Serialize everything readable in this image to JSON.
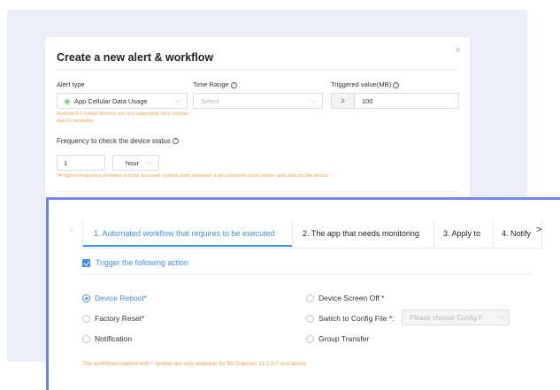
{
  "dialog": {
    "title": "Create a new alert & workflow",
    "close_icon": "×",
    "alert_type_label": "Alert type",
    "alert_type_value": "App Cellular Data Usage",
    "alert_type_note": "Android 6.0 below devices are not supported, only cellular data is available",
    "time_range_label": "Time Range",
    "time_range_placeholder": "Select",
    "triggered_label": "Triggered value(MB)",
    "triggered_operator": "≥",
    "triggered_value": "100",
    "frequency_label": "Frequency to check the device status",
    "frequency_value": "1",
    "frequency_unit": "hour",
    "frequency_note": "*A higher frequency provides a more accurate system alert; however it will consume more power and data on the device.",
    "help_icon": "?"
  },
  "workflow": {
    "prev_arrow": "‹",
    "next_arrow": ">",
    "tabs": [
      {
        "label": "1. Automated workflow that requires to be executed",
        "active": true
      },
      {
        "label": "2. The app that needs monitoring",
        "active": false
      },
      {
        "label": "3. Apply to",
        "active": false
      },
      {
        "label": "4. Notify",
        "active": false
      }
    ],
    "trigger_label": "Trigger the following action",
    "trigger_checked": true,
    "actions": [
      {
        "label": "Device Reboot*",
        "selected": true
      },
      {
        "label": "Device Screen Off *",
        "selected": false
      },
      {
        "label": "Factory Reset*",
        "selected": false
      },
      {
        "label": "Switch to Config File *:",
        "selected": false
      },
      {
        "label": "Notification",
        "selected": false
      },
      {
        "label": "Group Transfer",
        "selected": false
      }
    ],
    "config_placeholder": "Please choose Config F",
    "footnote": "The workflows marked with * symbol are only available for Biz Daemon v1.1.8.0 and above"
  },
  "colors": {
    "accent": "#3d8ff0",
    "warning": "#f0a050",
    "backdrop": "#eceef9",
    "panel_border": "#6e83e6"
  }
}
